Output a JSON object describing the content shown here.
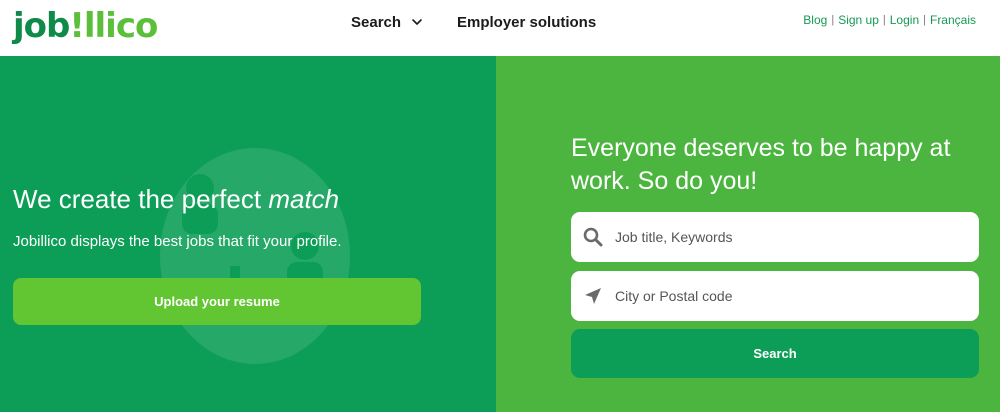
{
  "header": {
    "logo": {
      "part1": "job",
      "part2": "!llico"
    },
    "nav": {
      "search_label": "Search",
      "employer_label": "Employer solutions"
    },
    "links": {
      "blog": "Blog",
      "signup": "Sign up",
      "login": "Login",
      "language": "Français",
      "separator": "|"
    }
  },
  "hero": {
    "title_prefix": "We create the perfect ",
    "title_emphasis": "match",
    "subtitle": "Jobillico displays the best jobs that fit your profile.",
    "upload_label": "Upload your resume"
  },
  "search_panel": {
    "title": "Everyone deserves to be happy at work. So do you!",
    "job_placeholder": "Job title, Keywords",
    "city_placeholder": "City or Postal code",
    "search_label": "Search"
  },
  "colors": {
    "brand_dark_green": "#0c9e57",
    "brand_light_green": "#4cb53f",
    "button_green": "#62c532",
    "link_green": "#159a55"
  },
  "icons": [
    "chevron-down-icon",
    "search-icon",
    "location-arrow-icon"
  ]
}
